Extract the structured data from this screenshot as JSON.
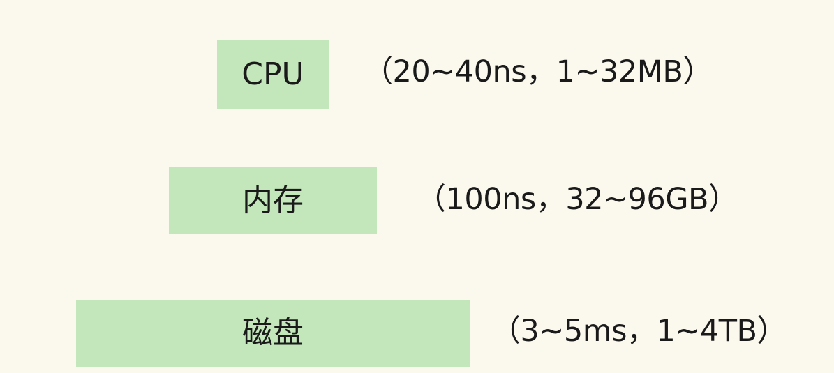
{
  "tiers": [
    {
      "name": "CPU",
      "spec": "（20~40ns，1~32MB）"
    },
    {
      "name": "内存",
      "spec": "（100ns，32~96GB）"
    },
    {
      "name": "磁盘",
      "spec": "（3~5ms，1~4TB）"
    }
  ],
  "colors": {
    "background": "#fbf8ee",
    "box_fill": "#c3e7bb",
    "text": "#1a1a1a"
  }
}
